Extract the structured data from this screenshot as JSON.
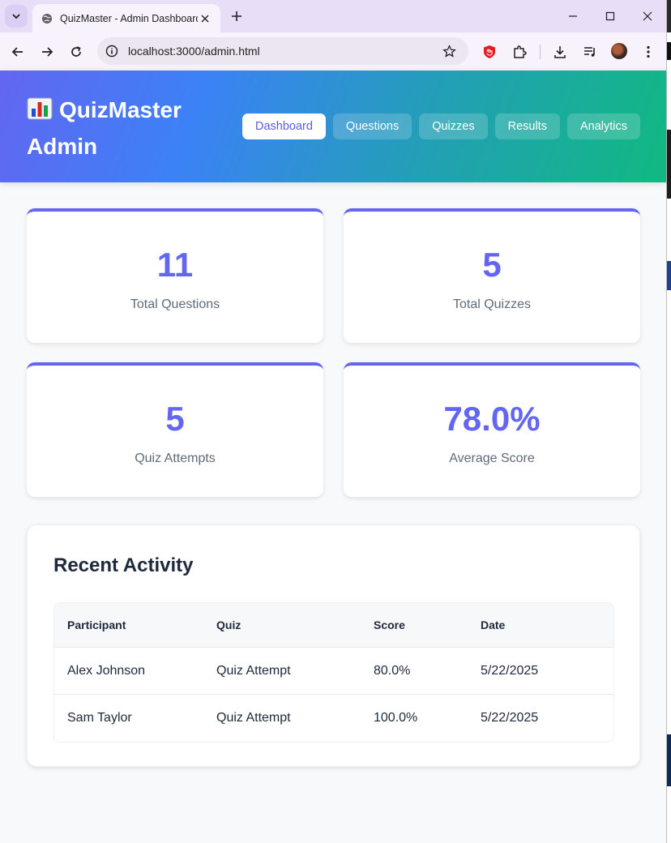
{
  "browser": {
    "tab_title": "QuizMaster - Admin Dashboard",
    "url": "localhost:3000/admin.html"
  },
  "header": {
    "brand_emoji": "📊",
    "brand_line1": "QuizMaster",
    "brand_line2": "Admin",
    "nav": [
      {
        "label": "Dashboard",
        "active": true
      },
      {
        "label": "Questions",
        "active": false
      },
      {
        "label": "Quizzes",
        "active": false
      },
      {
        "label": "Results",
        "active": false
      },
      {
        "label": "Analytics",
        "active": false
      }
    ]
  },
  "stats": [
    {
      "value": "11",
      "label": "Total Questions"
    },
    {
      "value": "5",
      "label": "Total Quizzes"
    },
    {
      "value": "5",
      "label": "Quiz Attempts"
    },
    {
      "value": "78.0%",
      "label": "Average Score"
    }
  ],
  "activity": {
    "title": "Recent Activity",
    "columns": [
      "Participant",
      "Quiz",
      "Score",
      "Date"
    ],
    "rows": [
      [
        "Alex Johnson",
        "Quiz Attempt",
        "80.0%",
        "5/22/2025"
      ],
      [
        "Sam Taylor",
        "Quiz Attempt",
        "100.0%",
        "5/22/2025"
      ]
    ]
  },
  "colors": {
    "accent": "#6366f1",
    "header_gradient_start": "#6366f1",
    "header_gradient_end": "#10b981"
  }
}
